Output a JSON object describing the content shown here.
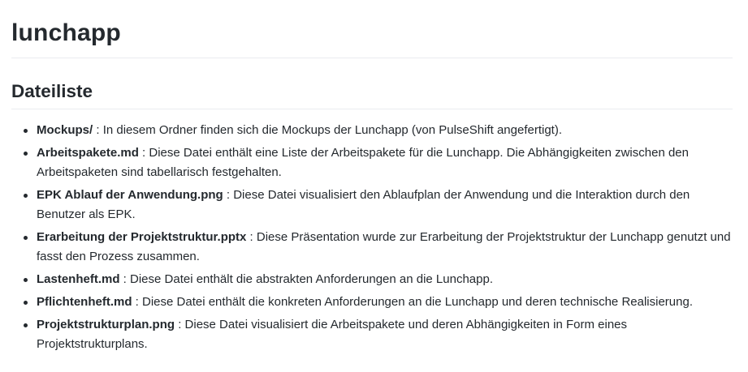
{
  "page": {
    "title": "lunchapp",
    "section_heading": "Dateiliste"
  },
  "files": [
    {
      "name": "Mockups/",
      "description": " : In diesem Ordner finden sich die Mockups der Lunchapp (von PulseShift angefertigt)."
    },
    {
      "name": "Arbeitspakete.md",
      "description": " : Diese Datei enthält eine Liste der Arbeitspakete für die Lunchapp. Die Abhängigkeiten zwischen den Arbeitspaketen sind tabellarisch festgehalten."
    },
    {
      "name": "EPK Ablauf der Anwendung.png",
      "description": " : Diese Datei visualisiert den Ablaufplan der Anwendung und die Interaktion durch den Benutzer als EPK."
    },
    {
      "name": "Erarbeitung der Projektstruktur.pptx",
      "description": " : Diese Präsentation wurde zur Erarbeitung der Projektstruktur der Lunchapp genutzt und fasst den Prozess zusammen."
    },
    {
      "name": "Lastenheft.md",
      "description": " : Diese Datei enthält die abstrakten Anforderungen an die Lunchapp."
    },
    {
      "name": "Pflichtenheft.md",
      "description": " : Diese Datei enthält die konkreten Anforderungen an die Lunchapp und deren technische Realisierung."
    },
    {
      "name": "Projektstrukturplan.png",
      "description": " : Diese Datei visualisiert die Arbeitspakete und deren Abhängigkeiten in Form eines Projektstrukturplans."
    }
  ]
}
